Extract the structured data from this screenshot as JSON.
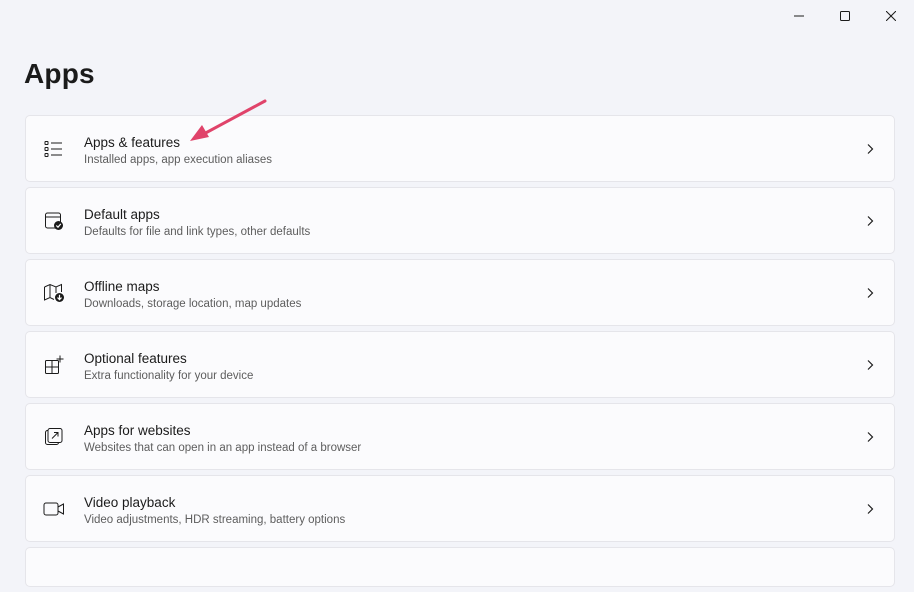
{
  "window": {
    "controls": {
      "minimize_icon": "minimize-icon",
      "maximize_icon": "maximize-icon",
      "close_icon": "close-icon"
    }
  },
  "page": {
    "title": "Apps"
  },
  "items": [
    {
      "title": "Apps & features",
      "subtitle": "Installed apps, app execution aliases",
      "icon": "list-icon"
    },
    {
      "title": "Default apps",
      "subtitle": "Defaults for file and link types, other defaults",
      "icon": "default-apps-icon"
    },
    {
      "title": "Offline maps",
      "subtitle": "Downloads, storage location, map updates",
      "icon": "map-download-icon"
    },
    {
      "title": "Optional features",
      "subtitle": "Extra functionality for your device",
      "icon": "grid-add-icon"
    },
    {
      "title": "Apps for websites",
      "subtitle": "Websites that can open in an app instead of a browser",
      "icon": "open-external-icon"
    },
    {
      "title": "Video playback",
      "subtitle": "Video adjustments, HDR streaming, battery options",
      "icon": "video-camera-icon"
    }
  ],
  "colors": {
    "background": "#f3f4f9",
    "card": "#fbfbfd",
    "card_border": "#e5e5ea",
    "annotation_arrow": "#e0436a"
  }
}
